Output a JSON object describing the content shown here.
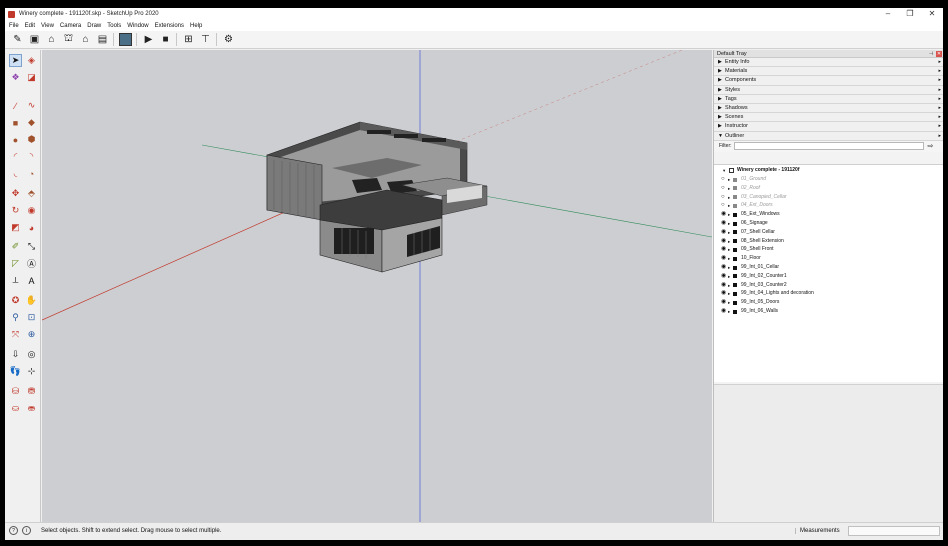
{
  "window": {
    "title": "Winery complete - 191120f.skp - SketchUp Pro 2020",
    "controls": [
      "–",
      "❐",
      "✕"
    ]
  },
  "menu": [
    "File",
    "Edit",
    "View",
    "Camera",
    "Draw",
    "Tools",
    "Window",
    "Extensions",
    "Help"
  ],
  "toolbar": {
    "buttons": [
      "pencil-paper-icon",
      "book-icon",
      "home-icon",
      "warehouse-icon",
      "house-icon",
      "storage-icon",
      "scene-thumbnail-icon",
      "play-icon",
      "stop-icon",
      "sandbox-icon",
      "stamp-icon",
      "gear-icon"
    ]
  },
  "tray": {
    "title": "Default Tray",
    "panels": [
      {
        "label": "Entity Info",
        "expanded": false
      },
      {
        "label": "Materials",
        "expanded": false
      },
      {
        "label": "Components",
        "expanded": false
      },
      {
        "label": "Styles",
        "expanded": false
      },
      {
        "label": "Tags",
        "expanded": false
      },
      {
        "label": "Shadows",
        "expanded": false
      },
      {
        "label": "Scenes",
        "expanded": false
      },
      {
        "label": "Instructor",
        "expanded": false
      },
      {
        "label": "Outliner",
        "expanded": true
      }
    ],
    "filter_label": "Filter:",
    "filter_value": ""
  },
  "outliner": {
    "root": "Winery complete - 191120f",
    "items": [
      {
        "name": "01_Ground",
        "visible": false
      },
      {
        "name": "02_Roof",
        "visible": false
      },
      {
        "name": "03_Canopied_Cellar",
        "visible": false
      },
      {
        "name": "04_Ext_Doors",
        "visible": false
      },
      {
        "name": "05_Ext_Windows",
        "visible": true
      },
      {
        "name": "06_Signage",
        "visible": true
      },
      {
        "name": "07_Shell Cellar",
        "visible": true
      },
      {
        "name": "08_Shell Extension",
        "visible": true
      },
      {
        "name": "09_Shell Front",
        "visible": true
      },
      {
        "name": "10_Floor",
        "visible": true
      },
      {
        "name": "99_Int_01_Cellar",
        "visible": true
      },
      {
        "name": "99_Int_02_Counter1",
        "visible": true
      },
      {
        "name": "99_Int_03_Counter2",
        "visible": true
      },
      {
        "name": "99_Int_04_Lights and decoration",
        "visible": true
      },
      {
        "name": "99_Int_05_Doors",
        "visible": true
      },
      {
        "name": "99_Int_06_Walls",
        "visible": true
      }
    ]
  },
  "status": {
    "message": "Select objects. Shift to extend select. Drag mouse to select multiple.",
    "measurements_label": "Measurements",
    "measurements_value": ""
  },
  "colors": {
    "viewport_bg": "#cdced2",
    "axis_red": "#c0392b",
    "axis_green": "#2e8b57",
    "axis_blue": "#3a4bd6"
  }
}
